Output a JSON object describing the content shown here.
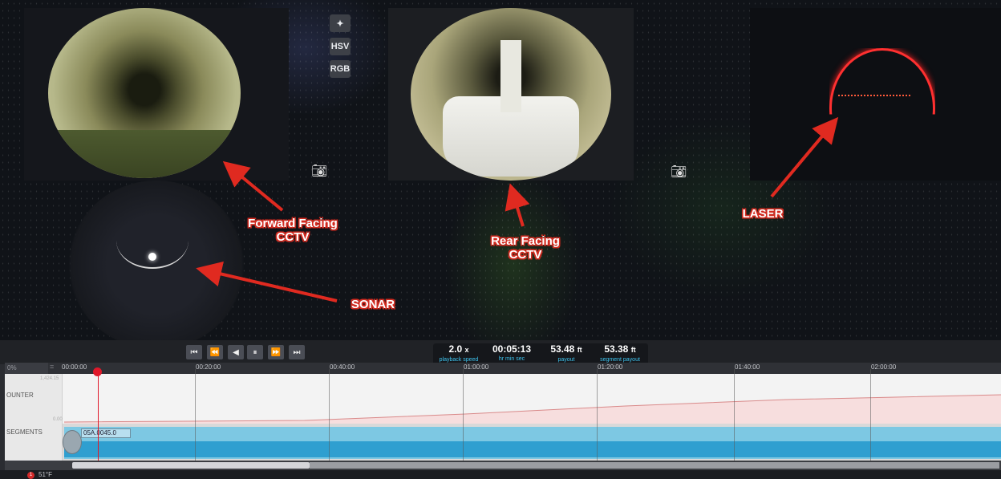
{
  "annotations": {
    "forward_cctv": "Forward Facing\nCCTV",
    "rear_cctv": "Rear Facing\nCCTV",
    "laser": "LASER",
    "sonar": "SONAR"
  },
  "view_tools": {
    "wand_icon": "magic-wand-icon",
    "hsv": "HSV",
    "rgb": "RGB"
  },
  "playback_controls": [
    "skip-to-start",
    "rewind",
    "step-back",
    "pause",
    "fast-forward",
    "skip-to-end"
  ],
  "stats": {
    "speed_value": "2.0",
    "speed_unit": "x",
    "speed_label": "playback speed",
    "time_value": "00:05:13",
    "time_label": "hr   min  sec",
    "payout_value": "53.48",
    "payout_unit": "ft",
    "payout_label": "payout",
    "segment_payout_value": "53.38",
    "segment_payout_unit": "ft",
    "segment_payout_label": "segment payout"
  },
  "timeline": {
    "zoom": "0%",
    "eq": "=",
    "ticks": [
      "00:00:00",
      "00:20:00",
      "00:40:00",
      "01:00:00",
      "01:20:00",
      "01:40:00",
      "02:00:00"
    ]
  },
  "tracks": {
    "counter_label": "OUNTER",
    "counter_max": "1,424.15",
    "counter_min": "0.00",
    "segments_label": "SEGMENTS",
    "segment_tag": "05A.0045.0"
  },
  "status": {
    "badge": "1",
    "text": "51°F"
  },
  "colors": {
    "accent": "#3ec5f0",
    "annotation": "#d22a1f",
    "playhead": "#e0182a",
    "segment": "#2f9fd0"
  }
}
